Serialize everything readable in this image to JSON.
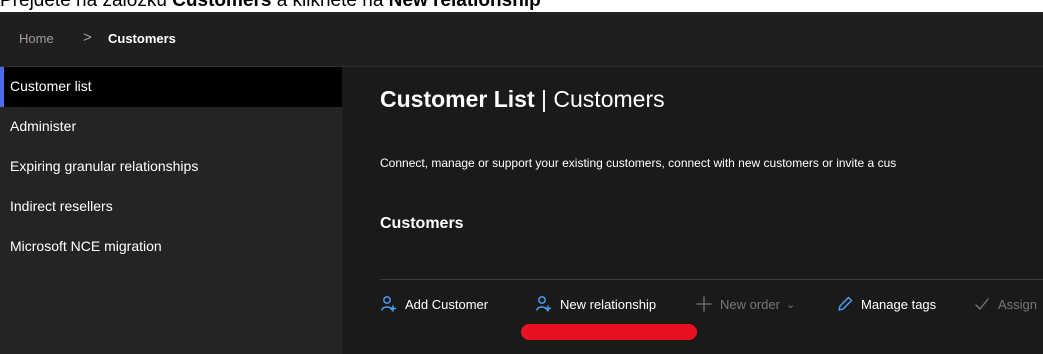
{
  "instruction_banner": {
    "prefix": "Přejděte na záložku ",
    "target": "Customers",
    "middle": " a klikněte na ",
    "action": "New relationship"
  },
  "breadcrumb": {
    "home": "Home",
    "separator": ">",
    "current": "Customers"
  },
  "sidebar": {
    "items": [
      {
        "label": "Customer list",
        "active": true
      },
      {
        "label": "Administer",
        "active": false
      },
      {
        "label": "Expiring granular relationships",
        "active": false
      },
      {
        "label": "Indirect resellers",
        "active": false
      },
      {
        "label": "Microsoft NCE migration",
        "active": false
      }
    ]
  },
  "main": {
    "title_strong": "Customer List",
    "title_sep": " | ",
    "title_rest": "Customers",
    "description": "Connect, manage or support your existing customers, connect with new customers or invite a cus",
    "section_title": "Customers",
    "toolbar": {
      "add_customer": "Add Customer",
      "new_relationship": "New relationship",
      "new_order": "New order",
      "manage_tags": "Manage tags",
      "assign": "Assign"
    }
  },
  "colors": {
    "page_bg": "#1b1a19",
    "sidebar_bg": "#252423",
    "active_item_bg": "#000000",
    "accent": "#4f6bed",
    "annotation": "#e81123"
  },
  "icons": {
    "add_customer": "person-add-icon",
    "new_relationship": "person-add-icon",
    "new_order": "plus-icon",
    "manage_tags": "pencil-icon",
    "assign": "checkmark-icon"
  }
}
